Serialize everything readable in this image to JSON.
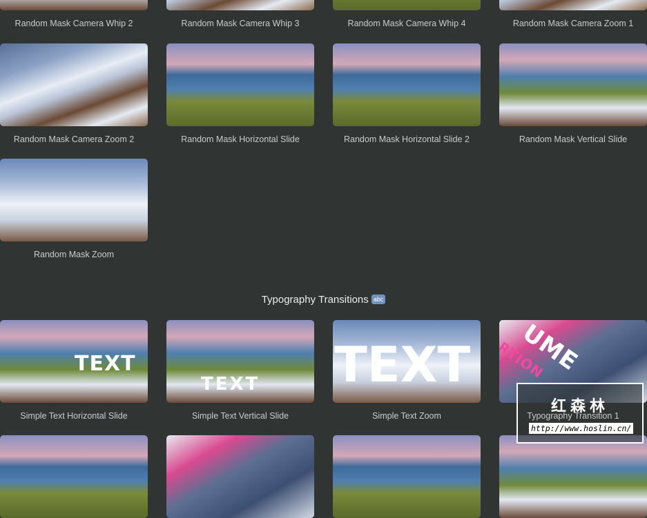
{
  "rows": [
    {
      "items": [
        {
          "label": "Random Mask Camera Whip 2"
        },
        {
          "label": "Random Mask Camera Whip 3"
        },
        {
          "label": "Random Mask Camera Whip 4"
        },
        {
          "label": "Random Mask Camera Zoom 1"
        }
      ]
    },
    {
      "items": [
        {
          "label": "Random Mask Camera Zoom 2"
        },
        {
          "label": "Random Mask Horizontal Slide"
        },
        {
          "label": "Random Mask Horizontal Slide 2"
        },
        {
          "label": "Random Mask Vertical Slide"
        }
      ]
    },
    {
      "items": [
        {
          "label": "Random Mask Zoom"
        }
      ]
    }
  ],
  "section": {
    "title": "Typography Transitions",
    "emoji": "abc"
  },
  "typography": {
    "items": [
      {
        "label": "Simple Text Horizontal Slide",
        "overlay": "TEXT"
      },
      {
        "label": "Simple Text Vertical Slide",
        "overlay": "TEXT"
      },
      {
        "label": "Simple Text Zoom",
        "overlay": "TEXT"
      },
      {
        "label": "Typography Transition 1",
        "overlay": "UME",
        "overlay2": "RTION"
      }
    ]
  },
  "watermark": {
    "cn": "红森林",
    "url": "http://www.hoslin.cn/"
  }
}
